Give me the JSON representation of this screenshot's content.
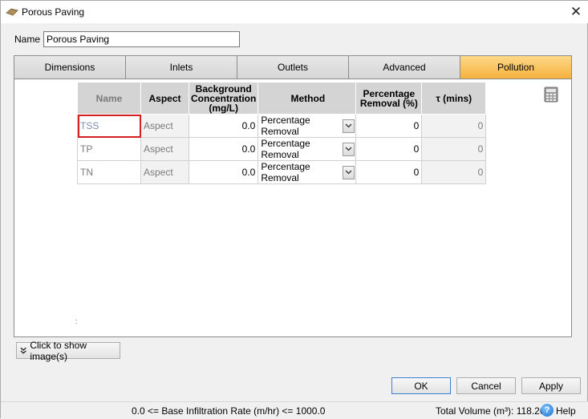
{
  "window": {
    "title": "Porous Paving",
    "close_symbol": "✕"
  },
  "name_field": {
    "label": "Name",
    "value": "Porous Paving"
  },
  "tabs": [
    {
      "label": "Dimensions",
      "active": false
    },
    {
      "label": "Inlets",
      "active": false
    },
    {
      "label": "Outlets",
      "active": false
    },
    {
      "label": "Advanced",
      "active": false
    },
    {
      "label": "Pollution",
      "active": true
    }
  ],
  "grid": {
    "headers": {
      "name": "Name",
      "aspect": "Aspect",
      "background": "Background Concentration (mg/L)",
      "method": "Method",
      "percentage": "Percentage Removal (%)",
      "tau": "τ (mins)"
    },
    "rows": [
      {
        "name": "TSS",
        "aspect": "Aspect",
        "background": "0.0",
        "method": "Percentage Removal",
        "percentage": "0",
        "tau": "0"
      },
      {
        "name": "TP",
        "aspect": "Aspect",
        "background": "0.0",
        "method": "Percentage Removal",
        "percentage": "0",
        "tau": "0"
      },
      {
        "name": "TN",
        "aspect": "Aspect",
        "background": "0.0",
        "method": "Percentage Removal",
        "percentage": "0",
        "tau": "0"
      }
    ]
  },
  "panel_mark": ":",
  "show_image_button": {
    "label": "Click to show image(s)"
  },
  "buttons": {
    "ok": "OK",
    "cancel": "Cancel",
    "apply": "Apply"
  },
  "status": {
    "range_text": "0.0 <= Base Infiltration Rate (m/hr) <= 1000.0",
    "total_volume": "Total Volume (m³): 118.263",
    "help_label": "Help"
  },
  "colors": {
    "active_tab": "#f5b23d",
    "selected_cell_border": "#d42020",
    "ok_border": "#3c7fd2"
  }
}
